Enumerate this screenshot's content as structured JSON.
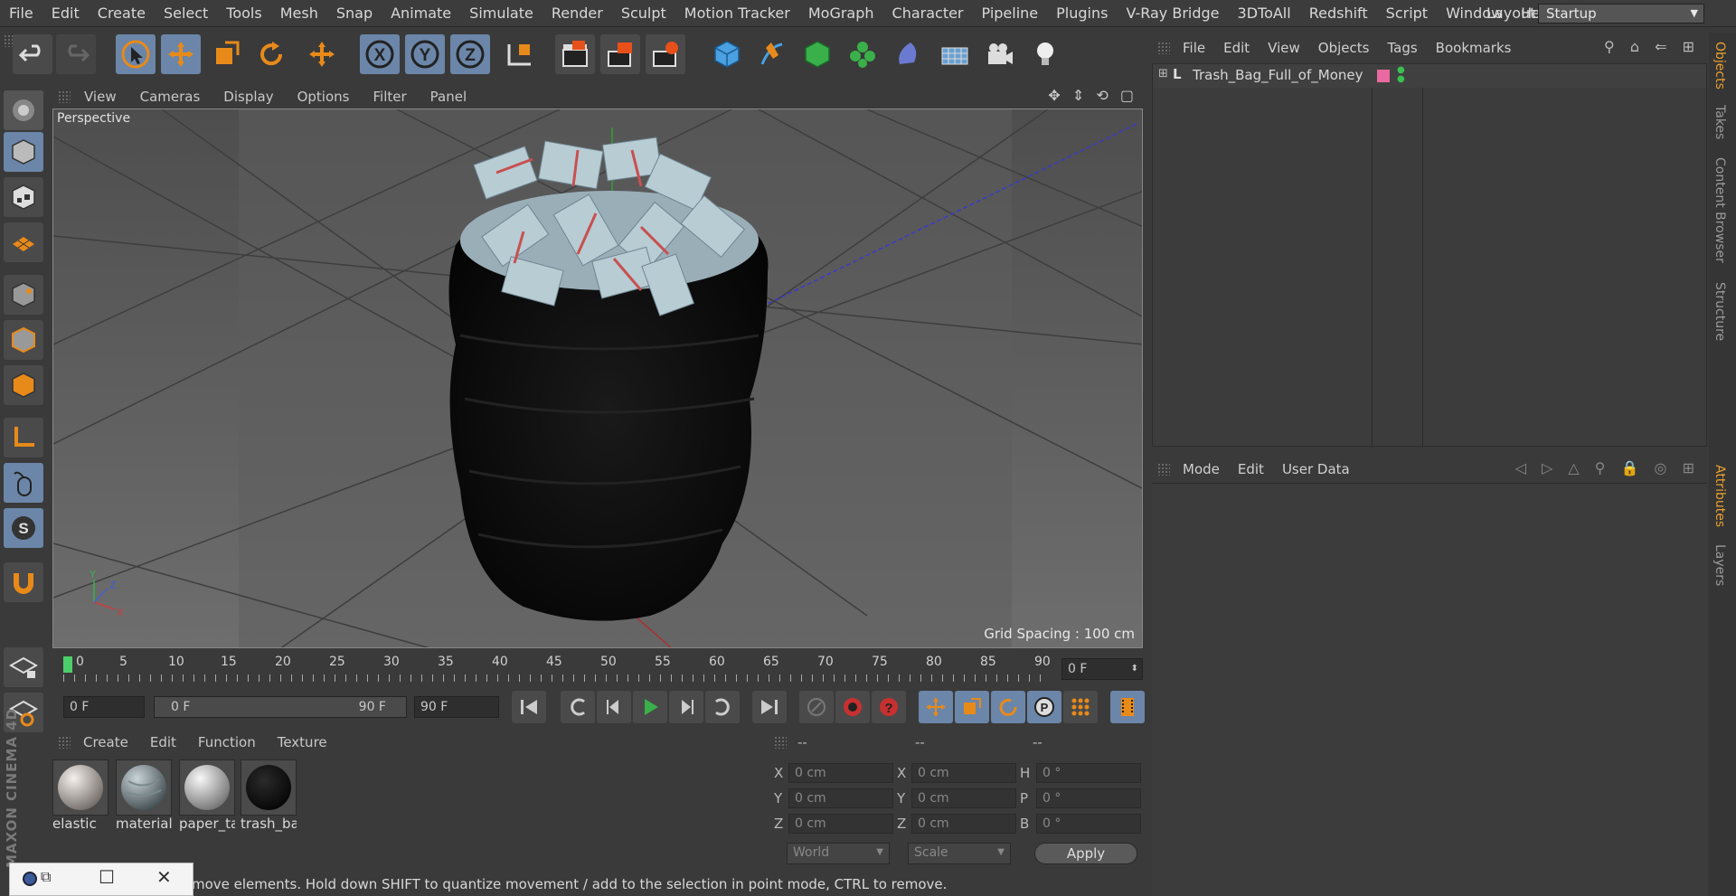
{
  "menubar": {
    "items": [
      "File",
      "Edit",
      "Create",
      "Select",
      "Tools",
      "Mesh",
      "Snap",
      "Animate",
      "Simulate",
      "Render",
      "Sculpt",
      "Motion Tracker",
      "MoGraph",
      "Character",
      "Pipeline",
      "Plugins",
      "V-Ray Bridge",
      "3DToAll",
      "Redshift",
      "Script",
      "Window",
      "Help"
    ],
    "layout_label": "Layout:",
    "layout_value": "Startup"
  },
  "viewport": {
    "menu": [
      "View",
      "Cameras",
      "Display",
      "Options",
      "Filter",
      "Panel"
    ],
    "label": "Perspective",
    "grid_spacing": "Grid Spacing : 100 cm"
  },
  "timeline": {
    "ticks": [
      "0",
      "5",
      "10",
      "15",
      "20",
      "25",
      "30",
      "35",
      "40",
      "45",
      "50",
      "55",
      "60",
      "65",
      "70",
      "75",
      "80",
      "85",
      "90"
    ],
    "current_frame": "0 F",
    "start_field": "0 F",
    "range_start": "0 F",
    "range_end": "90 F",
    "end_field": "90 F"
  },
  "materials": {
    "menu": [
      "Create",
      "Edit",
      "Function",
      "Texture"
    ],
    "items": [
      {
        "name": "elastic"
      },
      {
        "name": "material"
      },
      {
        "name": "paper_ta"
      },
      {
        "name": "trash_ba"
      }
    ]
  },
  "coords": {
    "headers": [
      "--",
      "--",
      "--"
    ],
    "rows": [
      {
        "a_lbl": "X",
        "a_val": "0 cm",
        "b_lbl": "X",
        "b_val": "0 cm",
        "c_lbl": "H",
        "c_val": "0 °"
      },
      {
        "a_lbl": "Y",
        "a_val": "0 cm",
        "b_lbl": "Y",
        "b_val": "0 cm",
        "c_lbl": "P",
        "c_val": "0 °"
      },
      {
        "a_lbl": "Z",
        "a_val": "0 cm",
        "b_lbl": "Z",
        "b_val": "0 cm",
        "c_lbl": "B",
        "c_val": "0 °"
      }
    ],
    "world": "World",
    "scale": "Scale",
    "apply": "Apply"
  },
  "objects": {
    "menu": [
      "File",
      "Edit",
      "View",
      "Objects",
      "Tags",
      "Bookmarks"
    ],
    "items": [
      {
        "name": "Trash_Bag_Full_of_Money",
        "layer_color": "#e86aa0"
      }
    ]
  },
  "attributes": {
    "menu": [
      "Mode",
      "Edit",
      "User Data"
    ]
  },
  "right_tabs": [
    "Objects",
    "Takes",
    "Content Browser",
    "Structure",
    "Attributes",
    "Layers"
  ],
  "status": "move elements. Hold down SHIFT to quantize movement / add to the selection in point mode, CTRL to remove.",
  "brand": "MAXON CINEMA 4D",
  "colors": {
    "accent_selected": "#6b86a8",
    "orange": "#e88a1a",
    "background": "#3a3a3a"
  }
}
